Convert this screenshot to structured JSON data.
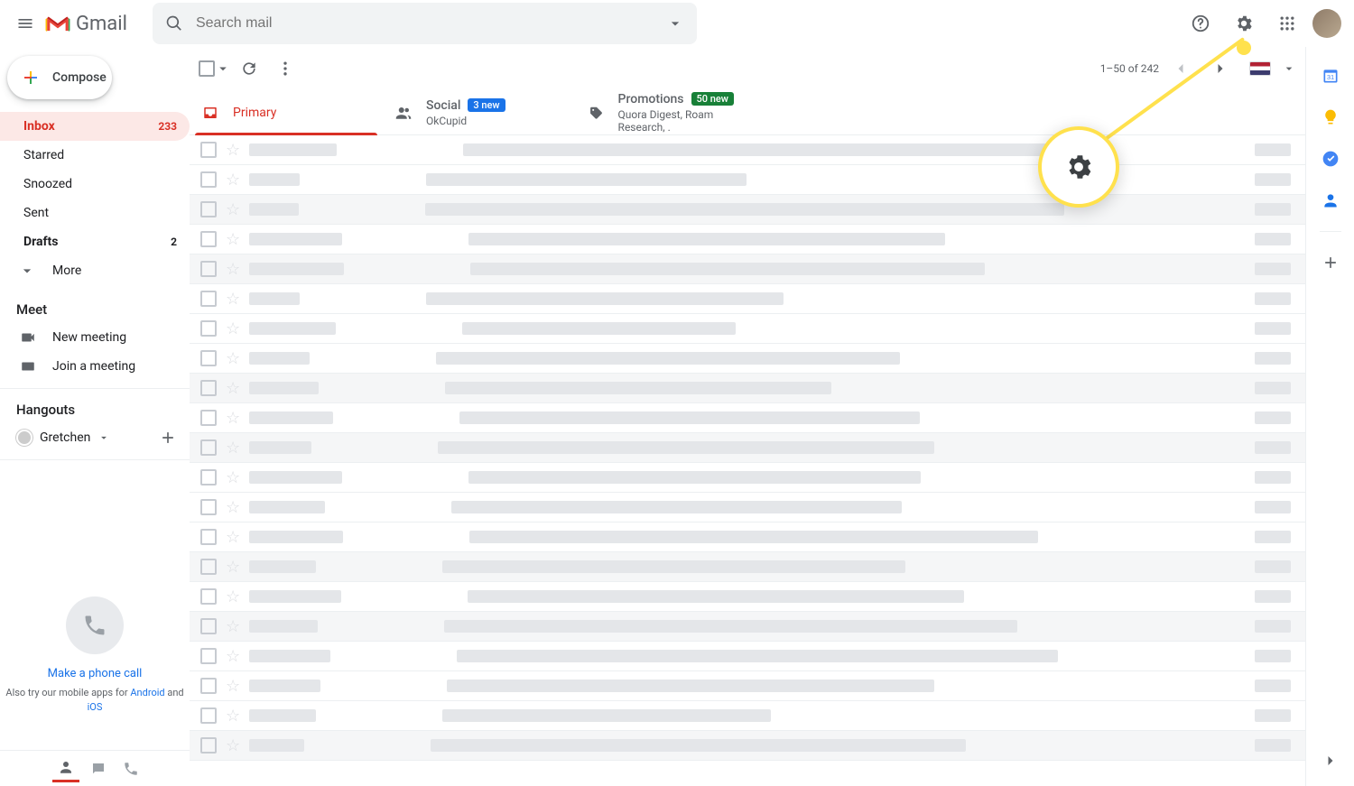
{
  "header": {
    "product_name": "Gmail",
    "search_placeholder": "Search mail"
  },
  "sidebar": {
    "compose_label": "Compose",
    "items": [
      {
        "label": "Inbox",
        "count": "233",
        "active": true,
        "bold": true
      },
      {
        "label": "Starred",
        "count": "",
        "active": false,
        "bold": false
      },
      {
        "label": "Snoozed",
        "count": "",
        "active": false,
        "bold": false
      },
      {
        "label": "Sent",
        "count": "",
        "active": false,
        "bold": false
      },
      {
        "label": "Drafts",
        "count": "2",
        "active": false,
        "bold": true
      },
      {
        "label": "More",
        "count": "",
        "active": false,
        "bold": false
      }
    ],
    "meet_title": "Meet",
    "meet_items": [
      {
        "label": "New meeting"
      },
      {
        "label": "Join a meeting"
      }
    ],
    "hangouts_title": "Hangouts",
    "hangouts_user": "Gretchen",
    "phone_cta": "Make a phone call",
    "mobile_prefix": "Also try our mobile apps for ",
    "mobile_android": "Android",
    "mobile_and": " and ",
    "mobile_ios": "iOS"
  },
  "toolbar": {
    "pagination": "1–50 of 242"
  },
  "tabs": {
    "primary": {
      "label": "Primary"
    },
    "social": {
      "label": "Social",
      "badge": "3 new",
      "subline": "OkCupid"
    },
    "promotions": {
      "label": "Promotions",
      "badge": "50 new",
      "subline": "Quora Digest, Roam Research, ."
    }
  },
  "list": {
    "row_count": 21
  },
  "rightrail": {
    "items": [
      "calendar",
      "keep",
      "tasks",
      "contacts"
    ]
  },
  "colors": {
    "accent_red": "#d93025",
    "badge_blue": "#1a73e8",
    "badge_green": "#188038",
    "callout_yellow": "#ffe14d"
  }
}
